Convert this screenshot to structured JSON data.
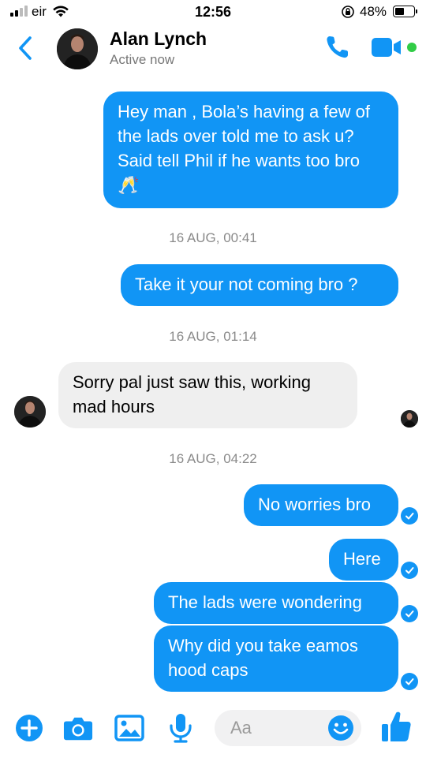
{
  "status_bar": {
    "carrier": "eir",
    "time": "12:56",
    "battery_percent": "48%",
    "battery_level": 0.48
  },
  "header": {
    "contact_name": "Alan Lynch",
    "contact_status": "Active now",
    "icons": [
      "back-chevron-icon",
      "phone-icon",
      "video-camera-icon"
    ],
    "accent_color": "#1195f5",
    "online_color": "#31cc46"
  },
  "messages": [
    {
      "direction": "outgoing",
      "text": "Hey man , Bola’s having a few of the lads over told me to ask u? Said tell Phil if he wants too bro 🥂"
    },
    {
      "timestamp": "16 AUG, 00:41"
    },
    {
      "direction": "outgoing",
      "text": "Take it your not coming bro ?"
    },
    {
      "timestamp": "16 AUG, 01:14"
    },
    {
      "direction": "incoming",
      "text": "Sorry pal just saw this, working mad hours"
    },
    {
      "timestamp": "16 AUG, 04:22"
    },
    {
      "direction": "outgoing",
      "text": "No worries bro",
      "status": "delivered"
    },
    {
      "direction": "outgoing",
      "text": "Here",
      "status": "delivered"
    },
    {
      "direction": "outgoing",
      "text": "The lads were wondering",
      "status": "delivered"
    },
    {
      "direction": "outgoing",
      "text": "Why did you take eamos hood caps",
      "status": "delivered"
    }
  ],
  "composer": {
    "placeholder": "Aa",
    "icons": [
      "plus-icon",
      "camera-icon",
      "gallery-icon",
      "microphone-icon",
      "emoji-icon",
      "thumbs-up-icon"
    ]
  }
}
